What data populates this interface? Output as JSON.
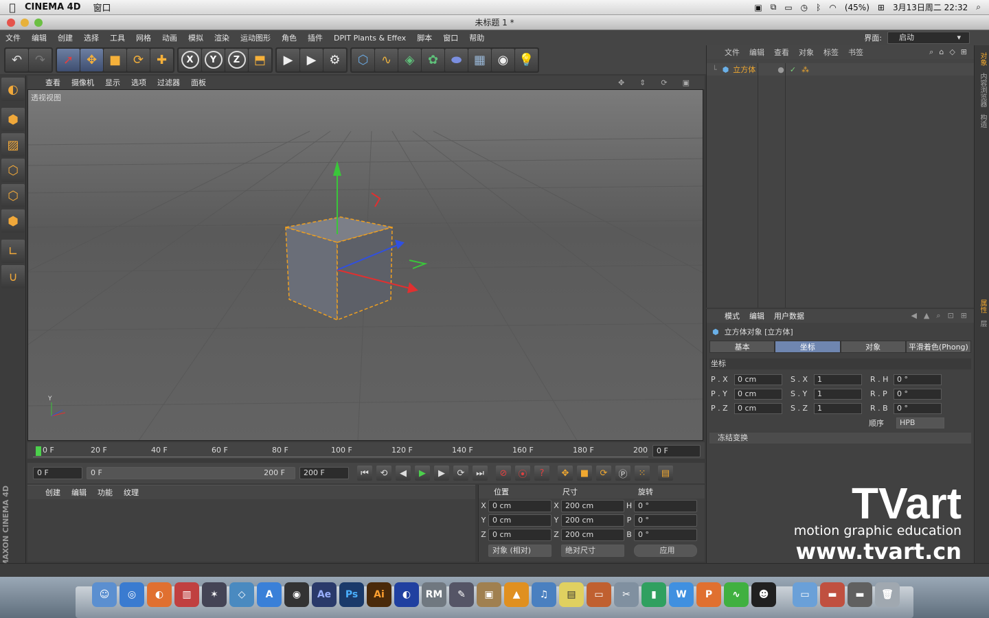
{
  "os_menubar": {
    "app_name": "CINEMA 4D",
    "menu": "窗口",
    "battery": "(45%)",
    "datetime": "3月13日周二  22:32"
  },
  "window": {
    "title": "未标题 1 *"
  },
  "main_menu": [
    "文件",
    "编辑",
    "创建",
    "选择",
    "工具",
    "网格",
    "动画",
    "模拟",
    "渲染",
    "运动图形",
    "角色",
    "插件",
    "DPIT Plants & Effex",
    "脚本",
    "窗口",
    "帮助"
  ],
  "layout": {
    "label": "界面:",
    "value": "启动"
  },
  "viewport": {
    "menu": [
      "查看",
      "摄像机",
      "显示",
      "选项",
      "过滤器",
      "面板"
    ],
    "label": "透视视图"
  },
  "timeline": {
    "ticks": [
      "0 F",
      "20 F",
      "40 F",
      "60 F",
      "80 F",
      "100 F",
      "120 F",
      "140 F",
      "160 F",
      "180 F",
      "200"
    ],
    "current": "0 F"
  },
  "transport": {
    "start": "0 F",
    "range_start": "0 F",
    "range_end": "200 F",
    "end": "200 F"
  },
  "material_manager": {
    "menu": [
      "创建",
      "编辑",
      "功能",
      "纹理"
    ]
  },
  "coord_manager": {
    "headers": [
      "位置",
      "尺寸",
      "旋转"
    ],
    "rows": [
      {
        "axis": "X",
        "pos": "0 cm",
        "size_axis": "X",
        "size": "200 cm",
        "rot_axis": "H",
        "rot": "0 °"
      },
      {
        "axis": "Y",
        "pos": "0 cm",
        "size_axis": "Y",
        "size": "200 cm",
        "rot_axis": "P",
        "rot": "0 °"
      },
      {
        "axis": "Z",
        "pos": "0 cm",
        "size_axis": "Z",
        "size": "200 cm",
        "rot_axis": "B",
        "rot": "0 °"
      }
    ],
    "mode": "对象 (相对)",
    "size_mode": "绝对尺寸",
    "apply": "应用"
  },
  "object_manager": {
    "menu": [
      "文件",
      "编辑",
      "查看",
      "对象",
      "标签",
      "书签"
    ],
    "objects": [
      "立方体"
    ]
  },
  "attribute_manager": {
    "menu": [
      "模式",
      "编辑",
      "用户数据"
    ],
    "object_title": "立方体对象 [立方体]",
    "tabs": [
      "基本",
      "坐标",
      "对象",
      "平滑着色(Phong)"
    ],
    "active_tab": "坐标",
    "section": "坐标",
    "rows": [
      {
        "p": "P . X",
        "pv": "0 cm",
        "s": "S . X",
        "sv": "1",
        "r": "R . H",
        "rv": "0 °"
      },
      {
        "p": "P . Y",
        "pv": "0 cm",
        "s": "S . Y",
        "sv": "1",
        "r": "R . P",
        "rv": "0 °"
      },
      {
        "p": "P . Z",
        "pv": "0 cm",
        "s": "S . Z",
        "sv": "1",
        "r": "R . B",
        "rv": "0 °"
      }
    ],
    "order_label": "顺序",
    "order_value": "HPB",
    "freeze": "冻结变换"
  },
  "side_tabs": [
    "对象",
    "内容浏览器",
    "构造",
    "属性",
    "层"
  ],
  "branding": {
    "maxon": "MAXON",
    "c4d": "CINEMA 4D",
    "tvart": "TVart",
    "tagline": "motion graphic education",
    "url": "www.tvart.cn"
  },
  "dock_apps": [
    "Finder",
    "Safari",
    "Firefox",
    "Parallels",
    "iMovie",
    "Preview",
    "App Store",
    "DVD",
    "AE",
    "Ps",
    "Ai",
    "C4D",
    "RM",
    "Quill",
    "Photo",
    "VLC",
    "iTunes",
    "Notes",
    "Keynote",
    "Tools",
    "Chart",
    "W",
    "P",
    "Wave",
    "QQ",
    "Folder",
    "Scanner",
    "Disk",
    "Trash"
  ]
}
